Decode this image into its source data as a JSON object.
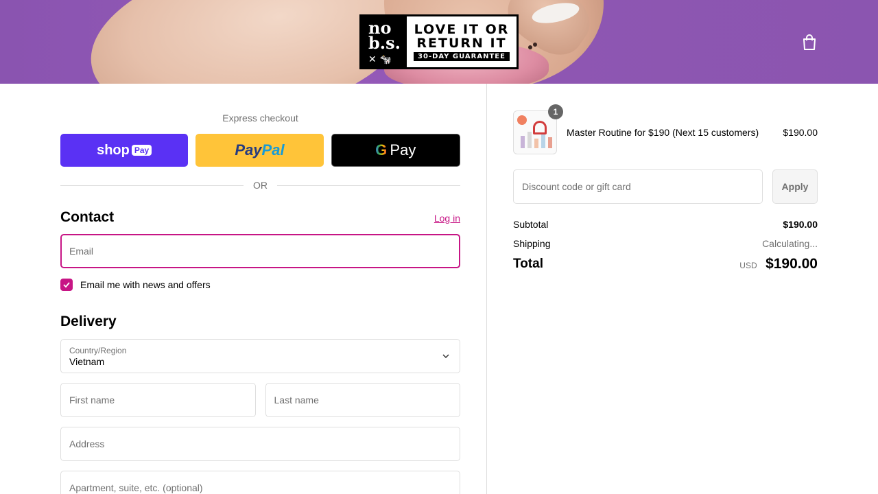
{
  "header": {
    "logo": {
      "left_line1": "no",
      "left_line2": "b.s.",
      "left_icons": "✕ 🐄",
      "line1": "LOVE IT OR",
      "line2": "RETURN IT",
      "line3": "30-DAY GUARANTEE"
    },
    "cart_icon": "shopping-bag-icon"
  },
  "express": {
    "title": "Express checkout",
    "shop_pay": {
      "shop": "shop",
      "pay": "Pay"
    },
    "paypal": {
      "pay": "Pay",
      "pal": "Pal"
    },
    "gpay": {
      "g": "G",
      "pay": "Pay"
    },
    "or": "OR"
  },
  "contact": {
    "title": "Contact",
    "login": "Log in",
    "email_placeholder": "Email",
    "news_label": "Email me with news and offers",
    "news_checked": true
  },
  "delivery": {
    "title": "Delivery",
    "country_label": "Country/Region",
    "country_value": "Vietnam",
    "first_name": "First name",
    "last_name": "Last name",
    "address": "Address",
    "apartment": "Apartment, suite, etc. (optional)"
  },
  "order": {
    "item": {
      "quantity": "1",
      "name": "Master Routine for $190 (Next 15 customers)",
      "price": "$190.00"
    },
    "discount_placeholder": "Discount code or gift card",
    "apply": "Apply",
    "subtotal_label": "Subtotal",
    "subtotal_value": "$190.00",
    "shipping_label": "Shipping",
    "shipping_value": "Calculating...",
    "total_label": "Total",
    "total_currency": "USD",
    "total_value": "$190.00"
  },
  "colors": {
    "accent": "#c71585",
    "shop_pay": "#5a31f4",
    "paypal": "#ffc439"
  }
}
